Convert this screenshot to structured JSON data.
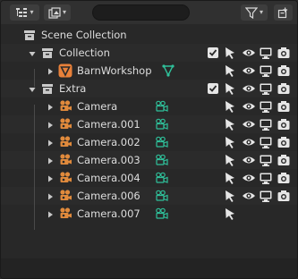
{
  "header": {
    "search": {
      "value": "",
      "placeholder": ""
    }
  },
  "rows": [
    {
      "name": "scene-collection",
      "label": "Scene Collection"
    },
    {
      "name": "collection",
      "label": "Collection"
    },
    {
      "name": "barnworkshop",
      "label": "BarnWorkshop"
    },
    {
      "name": "extra",
      "label": "Extra"
    },
    {
      "name": "camera",
      "label": "Camera"
    },
    {
      "name": "camera-001",
      "label": "Camera.001"
    },
    {
      "name": "camera-002",
      "label": "Camera.002"
    },
    {
      "name": "camera-003",
      "label": "Camera.003"
    },
    {
      "name": "camera-004",
      "label": "Camera.004"
    },
    {
      "name": "camera-006",
      "label": "Camera.006"
    },
    {
      "name": "camera-007",
      "label": "Camera.007"
    }
  ],
  "colors": {
    "background": "#282828",
    "header": "#303030",
    "camera_orange": "#e08a3c",
    "data_green": "#2fc09a",
    "mesh_orange": "#e8813a",
    "text": "#dddddd"
  },
  "icons": {
    "header": [
      "display-mode-icon",
      "view-layer-icon",
      "search-icon",
      "filter-icon",
      "new-collection-icon"
    ],
    "columns": [
      "checkbox-icon",
      "select-arrow-icon",
      "eye-icon",
      "monitor-icon",
      "camera-render-icon"
    ]
  }
}
